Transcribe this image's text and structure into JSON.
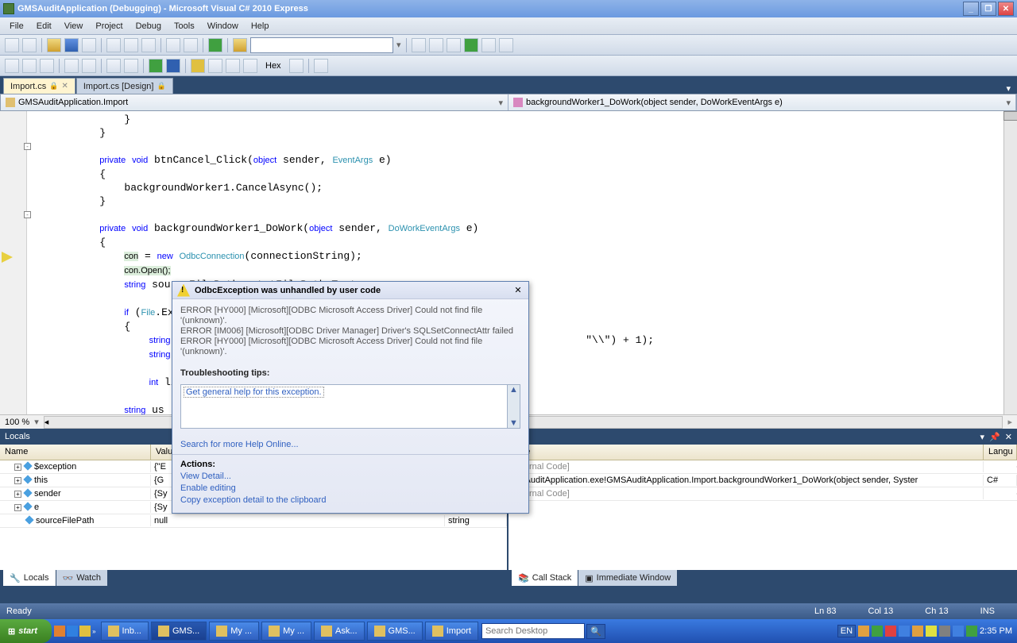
{
  "title": "GMSAuditApplication (Debugging) - Microsoft Visual C# 2010 Express",
  "menu": [
    "File",
    "Edit",
    "View",
    "Project",
    "Debug",
    "Tools",
    "Window",
    "Help"
  ],
  "hexLabel": "Hex",
  "tabs": [
    {
      "label": "Import.cs",
      "active": true,
      "lock": true,
      "close": true
    },
    {
      "label": "Import.cs [Design]",
      "active": false,
      "lock": true,
      "close": false
    }
  ],
  "nav": {
    "left": "GMSAuditApplication.Import",
    "right": "backgroundWorker1_DoWork(object sender, DoWorkEventArgs e)"
  },
  "zoom": "100 %",
  "locals": {
    "title": "Locals",
    "cols": [
      "Name",
      "Value",
      "Type"
    ],
    "rows": [
      {
        "name": "$exception",
        "value": "{\"E",
        "type": ""
      },
      {
        "name": "this",
        "value": "{G",
        "type": ""
      },
      {
        "name": "sender",
        "value": "{Sy",
        "type": ""
      },
      {
        "name": "e",
        "value": "{Sy",
        "type": ""
      },
      {
        "name": "sourceFilePath",
        "value": "null",
        "type": "string"
      }
    ],
    "tabs": [
      "Locals",
      "Watch"
    ]
  },
  "callstack": {
    "title": "ack",
    "cols": [
      "ame",
      "Langu"
    ],
    "rows": [
      {
        "name": "External Code]",
        "lang": ""
      },
      {
        "name": "MSAuditApplication.exe!GMSAuditApplication.Import.backgroundWorker1_DoWork(object sender, Syster",
        "lang": "C#"
      },
      {
        "name": "External Code]",
        "lang": ""
      }
    ],
    "tabs": [
      "Call Stack",
      "Immediate Window"
    ]
  },
  "status": {
    "ready": "Ready",
    "ln": "Ln 83",
    "col": "Col 13",
    "ch": "Ch 13",
    "ins": "INS"
  },
  "popup": {
    "title": "OdbcException was unhandled by user code",
    "body": "ERROR [HY000] [Microsoft][ODBC Microsoft Access Driver] Could not find file '(unknown)'.\nERROR [IM006] [Microsoft][ODBC Driver Manager] Driver's SQLSetConnectAttr failed\nERROR [HY000] [Microsoft][ODBC Microsoft Access Driver] Could not find file '(unknown)'.",
    "tips": "Troubleshooting tips:",
    "tiplink": "Get general help for this exception.",
    "search": "Search for more Help Online...",
    "actions_h": "Actions:",
    "actions": [
      "View Detail...",
      "Enable editing",
      "Copy exception detail to the clipboard"
    ]
  },
  "taskbar": {
    "start": "start",
    "items": [
      "Inb...",
      "GMS...",
      "My ...",
      "My ...",
      "Ask...",
      "GMS...",
      "Import"
    ],
    "search_ph": "Search Desktop",
    "lang": "EN",
    "time": "2:35 PM"
  }
}
